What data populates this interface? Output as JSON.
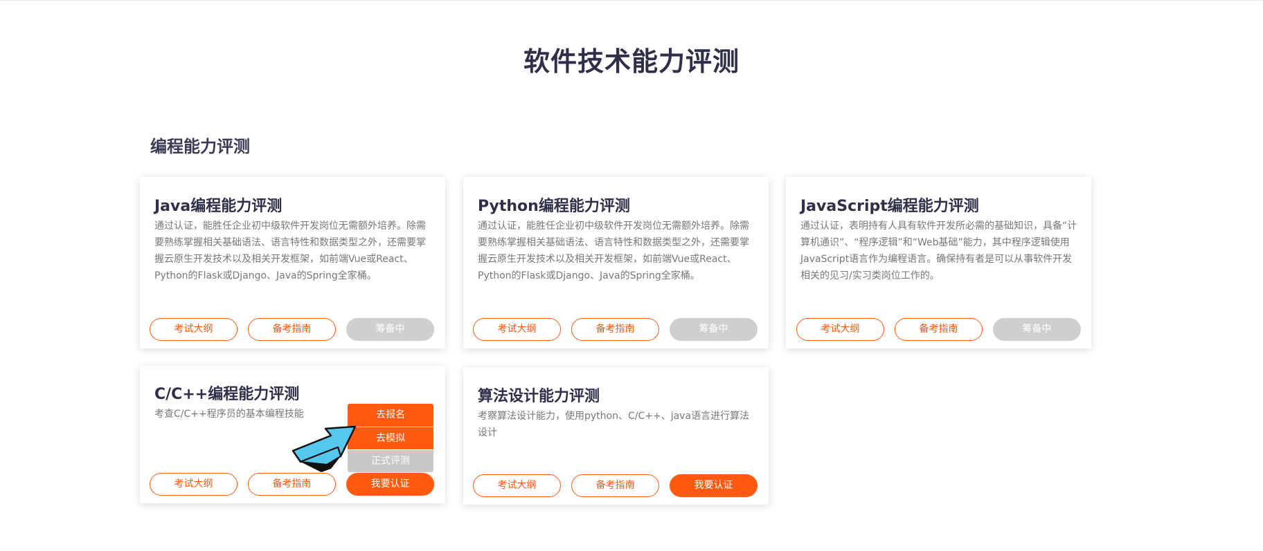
{
  "page": {
    "title": "软件技术能力评测"
  },
  "section": {
    "title": "编程能力评测"
  },
  "cards": [
    {
      "title": "Java编程能力评测",
      "desc": "通过认证，能胜任企业初中级软件开发岗位无需额外培养。除需要熟练掌握相关基础语法、语言特性和数据类型之外，还需要掌握云原生开发技术以及相关开发框架，如前端Vue或React、Python的Flask或Django、Java的Spring全家桶。",
      "btn_outline": "考试大纲",
      "btn_guide": "备考指南",
      "btn_action": "筹备中"
    },
    {
      "title": "Python编程能力评测",
      "desc": "通过认证，能胜任企业初中级软件开发岗位无需额外培养。除需要熟练掌握相关基础语法、语言特性和数据类型之外，还需要掌握云原生开发技术以及相关开发框架，如前端Vue或React、Python的Flask或Django、Java的Spring全家桶。",
      "btn_outline": "考试大纲",
      "btn_guide": "备考指南",
      "btn_action": "筹备中"
    },
    {
      "title": "JavaScript编程能力评测",
      "desc": "通过认证，表明持有人具有软件开发所必需的基础知识，具备“计算机通识”、“程序逻辑”和“Web基础”能力，其中程序逻辑使用JavaScript语言作为编程语言。确保持有者是可以从事软件开发相关的见习/实习类岗位工作的。",
      "btn_outline": "考试大纲",
      "btn_guide": "备考指南",
      "btn_action": "筹备中"
    },
    {
      "title": "C/C++编程能力评测",
      "desc": "考查C/C++程序员的基本编程技能",
      "btn_outline": "考试大纲",
      "btn_guide": "备考指南",
      "btn_action": "我要认证"
    },
    {
      "title": "算法设计能力评测",
      "desc": "考察算法设计能力，使用python、C/C++、java语言进行算法设计",
      "btn_outline": "考试大纲",
      "btn_guide": "备考指南",
      "btn_action": "我要认证"
    }
  ],
  "dropdown": {
    "items": [
      "去报名",
      "去模拟",
      "正式评测"
    ]
  },
  "colors": {
    "accent": "#ff5a0f",
    "disabled": "#cfcfcf",
    "title": "#2f2f4a",
    "pointer": "#56c8ee"
  },
  "icons": {
    "pointer": "pointer-arrow-icon"
  }
}
